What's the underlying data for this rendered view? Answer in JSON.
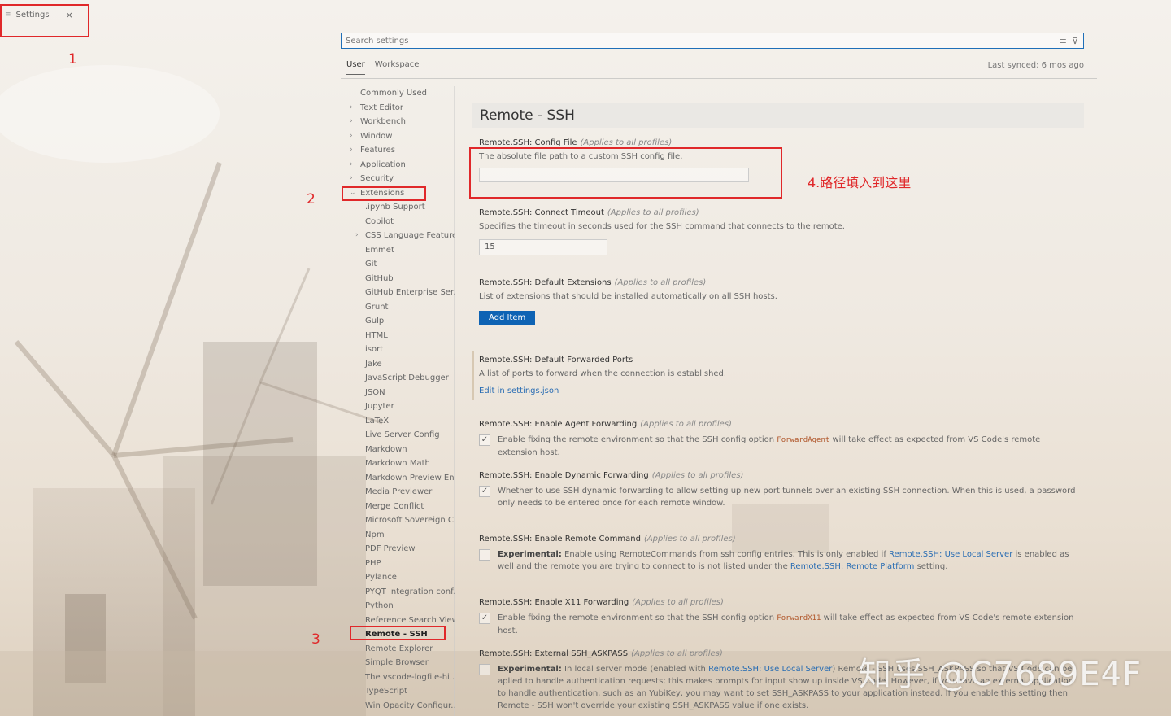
{
  "window": {
    "tab_label": "Settings",
    "close_glyph": "×"
  },
  "search": {
    "placeholder": "Search settings"
  },
  "scope_tabs": {
    "user": "User",
    "workspace": "Workspace"
  },
  "last_synced": "Last synced: 6 mos ago",
  "tree": [
    {
      "label": "Commonly Used",
      "level": 1,
      "chevron": ""
    },
    {
      "label": "Text Editor",
      "level": 1,
      "chevron": ">"
    },
    {
      "label": "Workbench",
      "level": 1,
      "chevron": ">"
    },
    {
      "label": "Window",
      "level": 1,
      "chevron": ">"
    },
    {
      "label": "Features",
      "level": 1,
      "chevron": ">"
    },
    {
      "label": "Application",
      "level": 1,
      "chevron": ">"
    },
    {
      "label": "Security",
      "level": 1,
      "chevron": ">"
    },
    {
      "label": "Extensions",
      "level": 1,
      "chevron": "v"
    },
    {
      "label": ".ipynb Support",
      "level": 2,
      "chevron": ""
    },
    {
      "label": "Copilot",
      "level": 2,
      "chevron": ""
    },
    {
      "label": "CSS Language Features",
      "level": 2,
      "chevron": ">"
    },
    {
      "label": "Emmet",
      "level": 2,
      "chevron": ""
    },
    {
      "label": "Git",
      "level": 2,
      "chevron": ""
    },
    {
      "label": "GitHub",
      "level": 2,
      "chevron": ""
    },
    {
      "label": "GitHub Enterprise Ser...",
      "level": 2,
      "chevron": ""
    },
    {
      "label": "Grunt",
      "level": 2,
      "chevron": ""
    },
    {
      "label": "Gulp",
      "level": 2,
      "chevron": ""
    },
    {
      "label": "HTML",
      "level": 2,
      "chevron": ""
    },
    {
      "label": "isort",
      "level": 2,
      "chevron": ""
    },
    {
      "label": "Jake",
      "level": 2,
      "chevron": ""
    },
    {
      "label": "JavaScript Debugger",
      "level": 2,
      "chevron": ""
    },
    {
      "label": "JSON",
      "level": 2,
      "chevron": ""
    },
    {
      "label": "Jupyter",
      "level": 2,
      "chevron": ""
    },
    {
      "label": "LaTeX",
      "level": 2,
      "chevron": ""
    },
    {
      "label": "Live Server Config",
      "level": 2,
      "chevron": ""
    },
    {
      "label": "Markdown",
      "level": 2,
      "chevron": ""
    },
    {
      "label": "Markdown Math",
      "level": 2,
      "chevron": ""
    },
    {
      "label": "Markdown Preview En...",
      "level": 2,
      "chevron": ""
    },
    {
      "label": "Media Previewer",
      "level": 2,
      "chevron": ""
    },
    {
      "label": "Merge Conflict",
      "level": 2,
      "chevron": ""
    },
    {
      "label": "Microsoft Sovereign C...",
      "level": 2,
      "chevron": ""
    },
    {
      "label": "Npm",
      "level": 2,
      "chevron": ""
    },
    {
      "label": "PDF Preview",
      "level": 2,
      "chevron": ""
    },
    {
      "label": "PHP",
      "level": 2,
      "chevron": ""
    },
    {
      "label": "Pylance",
      "level": 2,
      "chevron": ""
    },
    {
      "label": "PYQT integration conf...",
      "level": 2,
      "chevron": ""
    },
    {
      "label": "Python",
      "level": 2,
      "chevron": ""
    },
    {
      "label": "Reference Search View",
      "level": 2,
      "chevron": ""
    },
    {
      "label": "Remote - SSH",
      "level": 2,
      "chevron": "",
      "selected": true
    },
    {
      "label": "Remote Explorer",
      "level": 2,
      "chevron": ""
    },
    {
      "label": "Simple Browser",
      "level": 2,
      "chevron": ""
    },
    {
      "label": "The vscode-logfile-hi...",
      "level": 2,
      "chevron": ""
    },
    {
      "label": "TypeScript",
      "level": 2,
      "chevron": ""
    },
    {
      "label": "Win Opacity Configur...",
      "level": 2,
      "chevron": ""
    }
  ],
  "section_title": "Remote - SSH",
  "applies": "(Applies to all profiles)",
  "settings": {
    "config_file": {
      "title": "Remote.SSH: Config File",
      "desc": "The absolute file path to a custom SSH config file.",
      "value": ""
    },
    "connect_timeout": {
      "title": "Remote.SSH: Connect Timeout",
      "desc": "Specifies the timeout in seconds used for the SSH command that connects to the remote.",
      "value": "15"
    },
    "default_extensions": {
      "title": "Remote.SSH: Default Extensions",
      "desc": "List of extensions that should be installed automatically on all SSH hosts.",
      "button": "Add Item"
    },
    "forwarded_ports": {
      "title": "Remote.SSH: Default Forwarded Ports",
      "desc": "A list of ports to forward when the connection is established.",
      "link": "Edit in settings.json"
    },
    "agent_forwarding": {
      "title": "Remote.SSH: Enable Agent Forwarding",
      "pre": "Enable fixing the remote environment so that the SSH config option ",
      "code": "ForwardAgent",
      "post": " will take effect as expected from VS Code's remote extension host.",
      "checked": true
    },
    "dynamic_forwarding": {
      "title": "Remote.SSH: Enable Dynamic Forwarding",
      "desc": "Whether to use SSH dynamic forwarding to allow setting up new port tunnels over an existing SSH connection. When this is used, a password only needs to be entered once for each remote window.",
      "checked": true
    },
    "remote_command": {
      "title": "Remote.SSH: Enable Remote Command",
      "bold": "Experimental:",
      "p1": " Enable using RemoteCommands from ssh config entries. This is only enabled if ",
      "link1": "Remote.SSH: Use Local Server",
      "p2": " is enabled as well and the remote you are trying to connect to is not listed under the ",
      "link2": "Remote.SSH: Remote Platform",
      "p3": " setting.",
      "checked": false
    },
    "x11_forwarding": {
      "title": "Remote.SSH: Enable X11 Forwarding",
      "pre": "Enable fixing the remote environment so that the SSH config option ",
      "code": "ForwardX11",
      "post": " will take effect as expected from VS Code's remote extension host.",
      "checked": true
    },
    "askpass": {
      "title": "Remote.SSH: External SSH_ASKPASS",
      "bold": "Experimental:",
      "p1": " In local server mode (enabled with ",
      "link1": "Remote.SSH: Use Local Server",
      "p2": ") Remote - SSH uses SSH_ASKPASS so that VS Code can be aplied to handle authentication requests; this makes prompts for input show up inside VS Code. However, if you have an external application to handle authentication, such as an YubiKey, you may want to set SSH_ASKPASS to your application instead. If you enable this setting then Remote - SSH won't override your existing SSH_ASKPASS value if one exists.",
      "checked": false
    }
  },
  "annotations": {
    "n1": "1",
    "n2": "2",
    "n3": "3",
    "n4": "4.路径填入到这里",
    "color": "#e0282a"
  },
  "watermark": "知乎 @C7689E4F"
}
